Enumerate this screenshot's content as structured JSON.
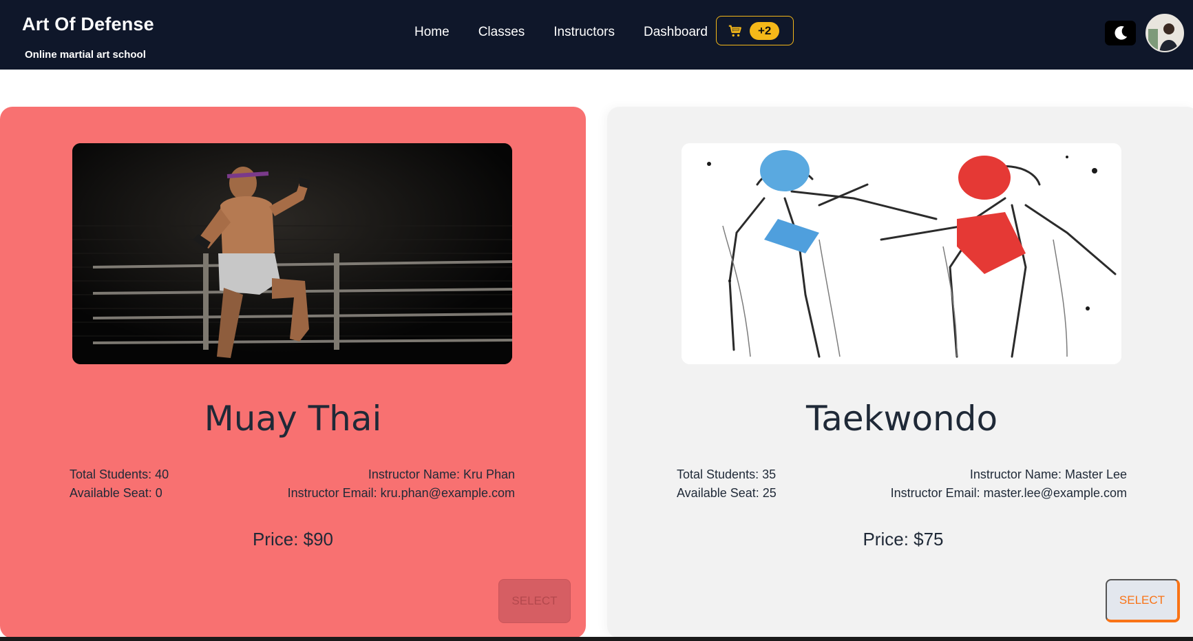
{
  "brand": {
    "title": "Art Of Defense",
    "subtitle": "Online martial art school"
  },
  "nav": [
    "Home",
    "Classes",
    "Instructors",
    "Dashboard"
  ],
  "cart": {
    "badge": "+2",
    "color": "#f5b819"
  },
  "theme_icon": "moon-icon",
  "classes": [
    {
      "name": "Muay Thai",
      "total_students": "Total Students: 40",
      "available_seat": "Available Seat: 0",
      "instructor_name": "Instructor Name: Kru Phan",
      "instructor_email": "Instructor Email: kru.phan@example.com",
      "price": "Price: $90",
      "button": "SELECT",
      "bg": "#f87171",
      "disabled": true
    },
    {
      "name": "Taekwondo",
      "total_students": "Total Students: 35",
      "available_seat": "Available Seat: 25",
      "instructor_name": "Instructor Name: Master Lee",
      "instructor_email": "Instructor Email: master.lee@example.com",
      "price": "Price: $75",
      "button": "SELECT",
      "bg": "#f2f2f2",
      "disabled": false
    }
  ]
}
